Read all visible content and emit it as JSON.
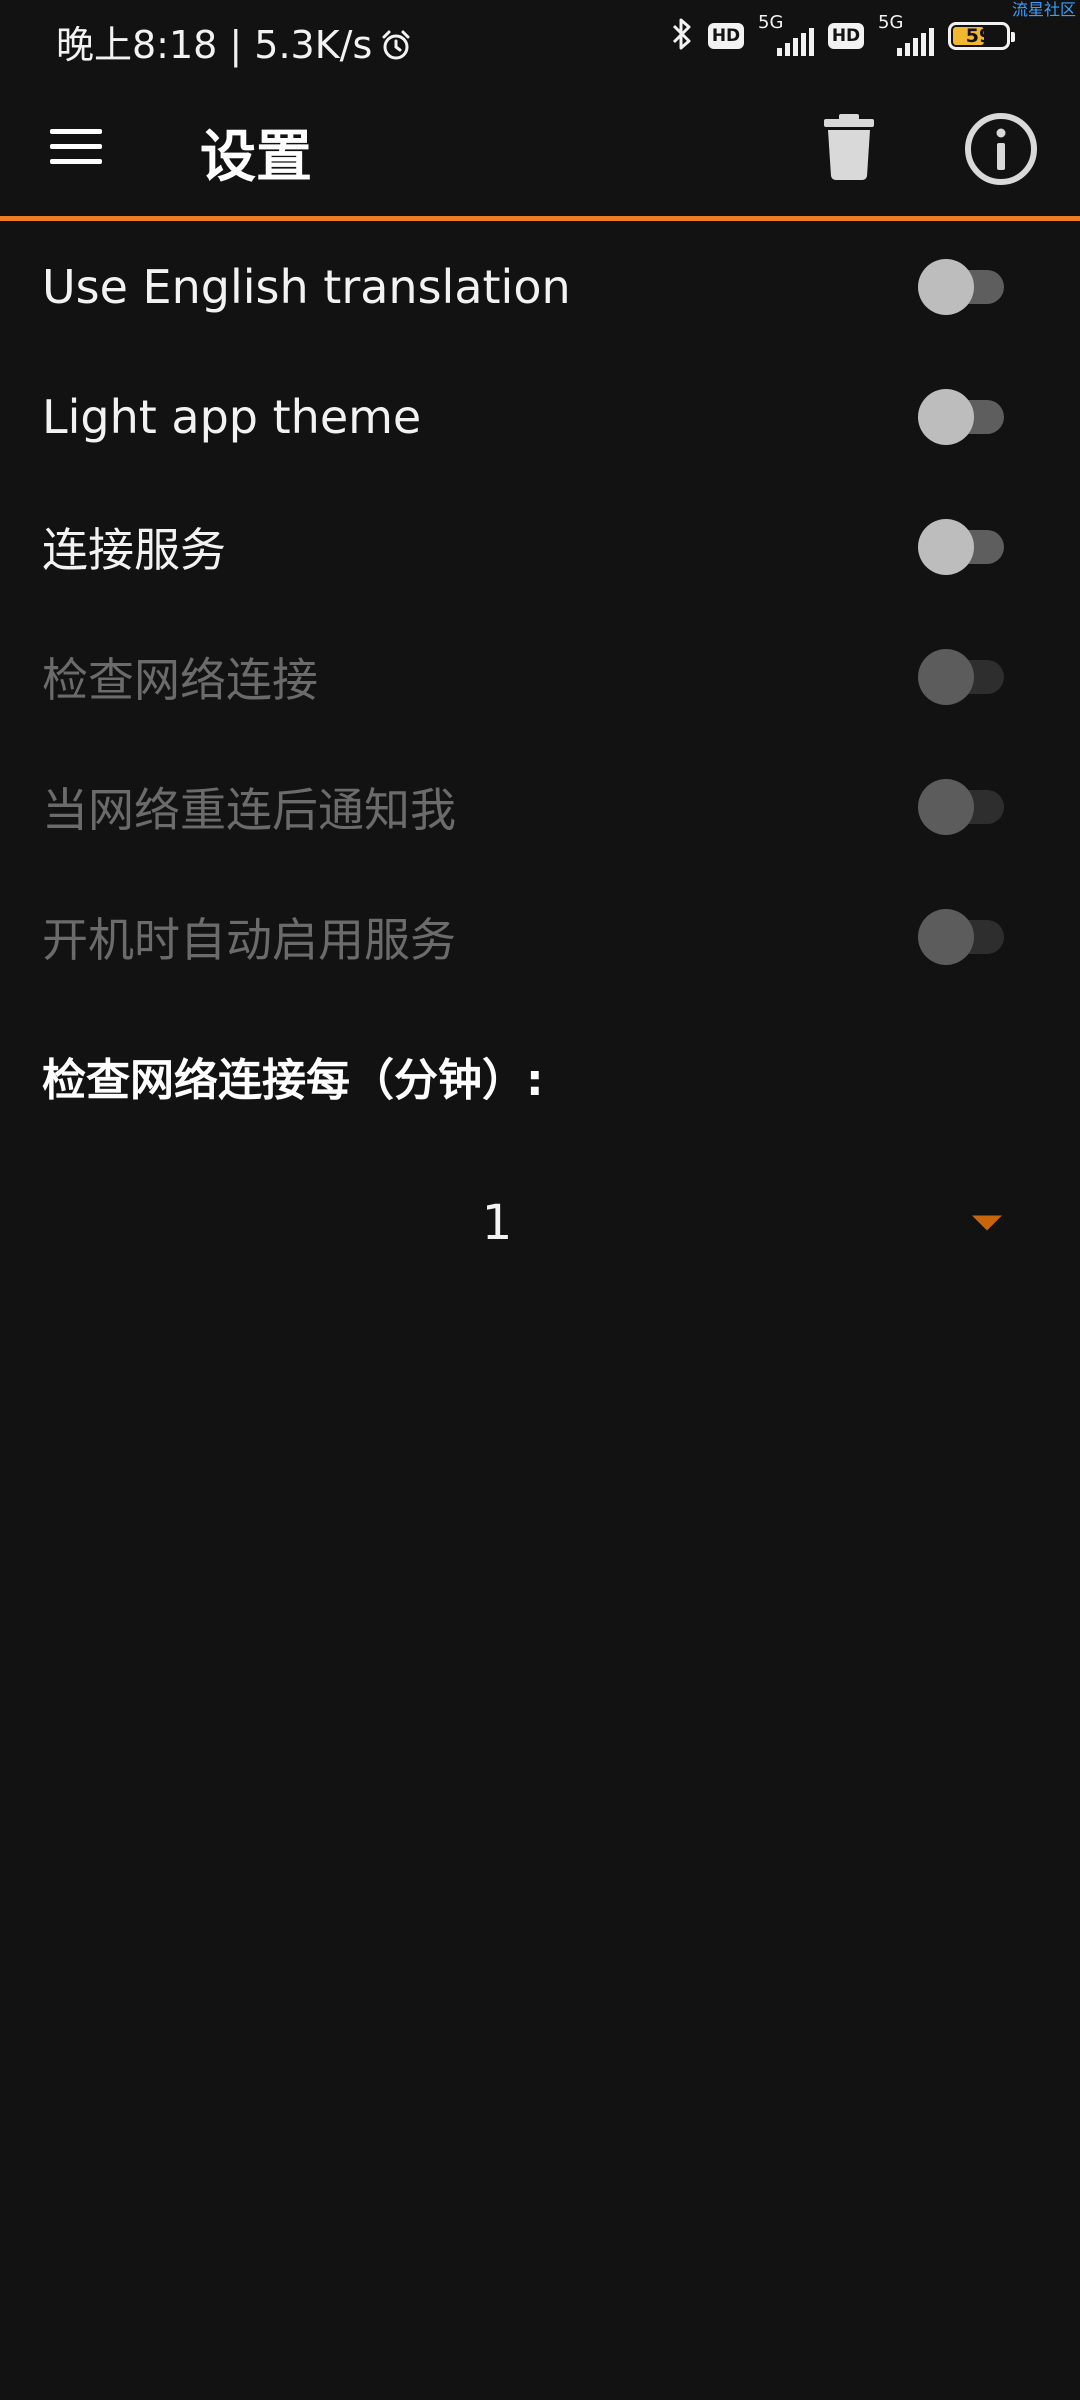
{
  "status_bar": {
    "time_speed": "晚上8:18 | 5.3K/s",
    "hd_label": "HD",
    "network_1": "5G",
    "network_2": "5G",
    "battery_percent": "59",
    "battery_level": 0.59,
    "watermark": "流星社区",
    "icons": [
      "alarm-icon",
      "bluetooth-icon",
      "signal-icon",
      "battery-icon"
    ]
  },
  "toolbar": {
    "title": "设置",
    "menu_icon": "hamburger-menu-icon",
    "delete_icon": "trash-icon",
    "info_icon": "info-icon"
  },
  "colors": {
    "background": "#121212",
    "accent": "#ee7d22",
    "text": "#f2f2f2",
    "disabled_text": "#6b6b6b"
  },
  "settings": [
    {
      "label": "Use English translation",
      "enabled": true,
      "checked": false
    },
    {
      "label": "Light app theme",
      "enabled": true,
      "checked": false
    },
    {
      "label": "连接服务",
      "enabled": true,
      "checked": false
    },
    {
      "label": "检查网络连接",
      "enabled": false,
      "checked": false
    },
    {
      "label": "当网络重连后通知我",
      "enabled": false,
      "checked": false
    },
    {
      "label": "开机时自动启用服务",
      "enabled": false,
      "checked": false
    }
  ],
  "interval": {
    "header": "检查网络连接每（分钟）:",
    "selected_value": "1"
  }
}
